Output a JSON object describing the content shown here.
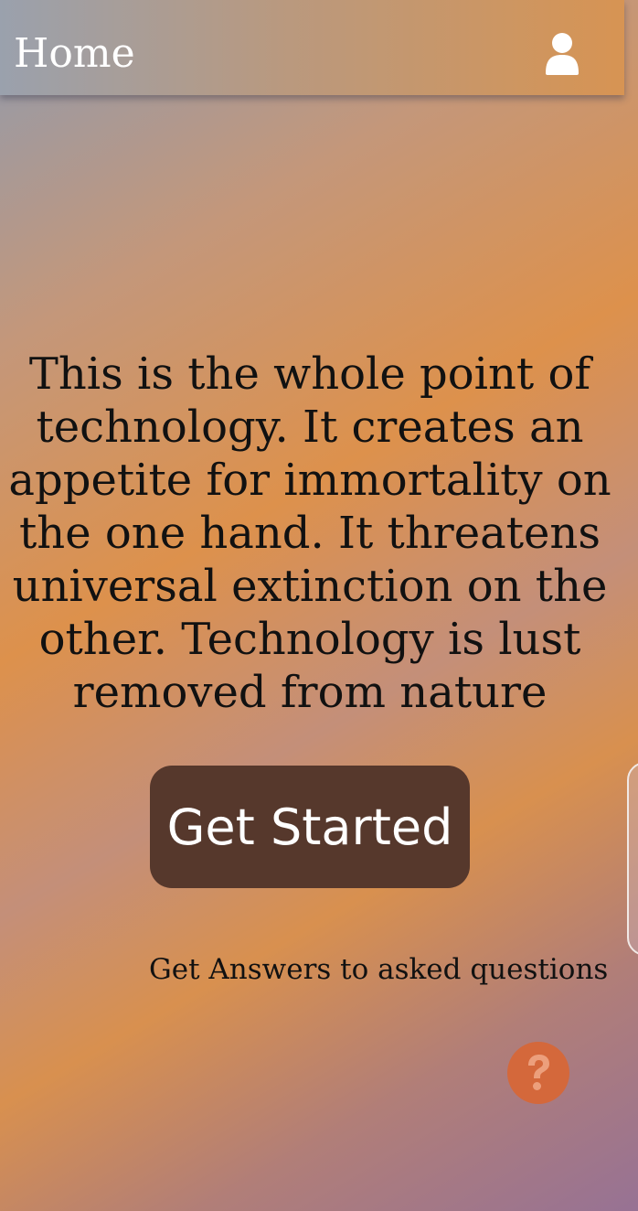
{
  "header": {
    "title": "Home",
    "user_icon": "user-icon"
  },
  "main": {
    "quote": "This is the whole point of technology. It creates an appetite for immortality on the one hand. It threatens universal extinction on the other. Technology is lust removed from nature",
    "cta_label": "Get Started",
    "faq_link": "Get Answers to asked questions",
    "help_icon": "question-circle-icon"
  },
  "colors": {
    "header_text": "#ffffff",
    "cta_background": "#56382c",
    "help_icon": "#d4683b",
    "body_text": "#111111"
  }
}
